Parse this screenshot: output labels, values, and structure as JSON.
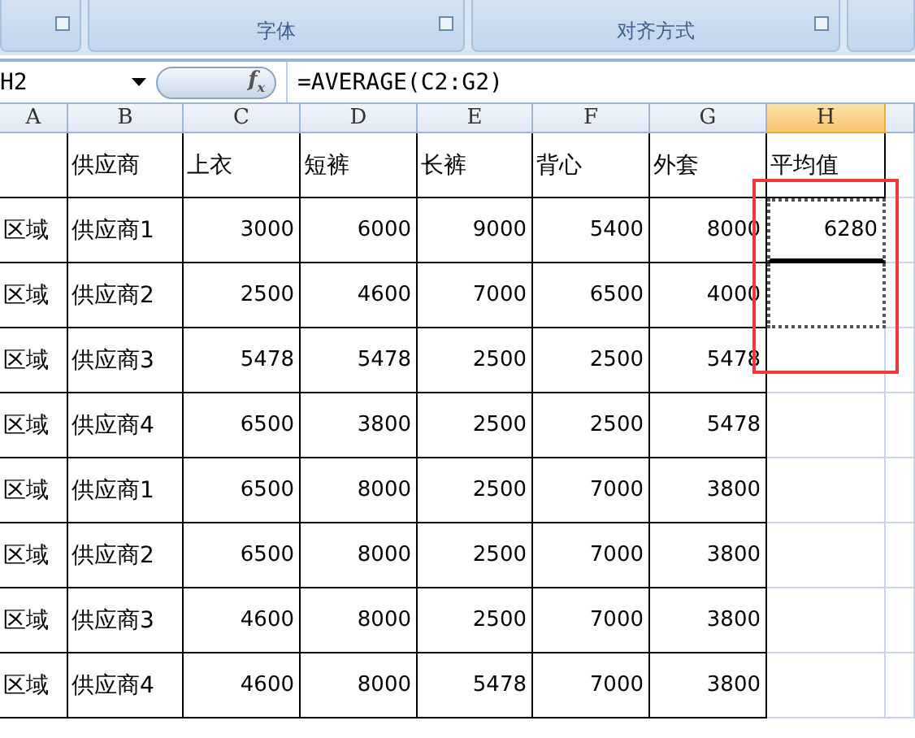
{
  "ribbon": {
    "groups": [
      {
        "label": "字体"
      },
      {
        "label": "对齐方式"
      }
    ]
  },
  "formula_bar": {
    "name_box": "H2",
    "function_button": "f$_{x}$",
    "formula": "=AVERAGE(C2:G2)"
  },
  "columns": [
    {
      "label": "A",
      "selected": false
    },
    {
      "label": "B",
      "selected": false
    },
    {
      "label": "C",
      "selected": false
    },
    {
      "label": "D",
      "selected": false
    },
    {
      "label": "E",
      "selected": false
    },
    {
      "label": "F",
      "selected": false
    },
    {
      "label": "G",
      "selected": false
    },
    {
      "label": "H",
      "selected": true
    }
  ],
  "header": {
    "cells": [
      "供应商",
      "上衣",
      "短裤",
      "长裤",
      "背心",
      "外套"
    ],
    "average_label": "平均值"
  },
  "rows": [
    {
      "region": "区域",
      "supplier": "供应商1",
      "values": [
        "3000",
        "6000",
        "9000",
        "5400",
        "8000"
      ],
      "average": "6280"
    },
    {
      "region": "区域",
      "supplier": "供应商2",
      "values": [
        "2500",
        "4600",
        "7000",
        "6500",
        "4000"
      ]
    },
    {
      "region": "区域",
      "supplier": "供应商3",
      "values": [
        "5478",
        "5478",
        "2500",
        "2500",
        "5478"
      ]
    },
    {
      "region": "区域",
      "supplier": "供应商4",
      "values": [
        "6500",
        "3800",
        "2500",
        "2500",
        "5478"
      ]
    },
    {
      "region": "区域",
      "supplier": "供应商1",
      "values": [
        "6500",
        "8000",
        "2500",
        "7000",
        "3800"
      ]
    },
    {
      "region": "区域",
      "supplier": "供应商2",
      "values": [
        "6500",
        "8000",
        "2500",
        "7000",
        "3800"
      ]
    },
    {
      "region": "区域",
      "supplier": "供应商3",
      "values": [
        "4600",
        "8000",
        "2500",
        "7000",
        "3800"
      ]
    },
    {
      "region": "区域",
      "supplier": "供应商4",
      "values": [
        "4600",
        "8000",
        "5478",
        "7000",
        "3800"
      ]
    }
  ]
}
